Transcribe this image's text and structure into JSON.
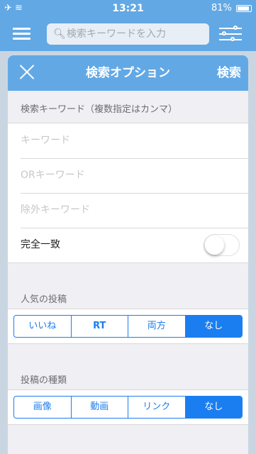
{
  "status_bar": {
    "time": "13:21",
    "battery": "81%"
  },
  "app_bar": {
    "search_placeholder": "検索キーワードを入力"
  },
  "modal": {
    "close_label": "×",
    "title": "検索オプション",
    "search_button": "検索",
    "keyword_section": {
      "label": "検索キーワード（複数指定はカンマ）",
      "keyword_placeholder": "キーワード",
      "or_keyword_placeholder": "ORキーワード",
      "exclude_keyword_placeholder": "除外キーワード",
      "exact_match_label": "完全一致",
      "exact_match_on": false
    },
    "popular_section": {
      "label": "人気の投稿",
      "options": [
        "いいね",
        "RT",
        "両方",
        "なし"
      ],
      "selected": "なし"
    },
    "type_section": {
      "label": "投稿の種類",
      "options": [
        "画像",
        "動画",
        "リンク",
        "なし"
      ],
      "selected": "なし"
    }
  },
  "colors": {
    "header_blue": "#62a8e5",
    "segment_blue": "#1b7ef0"
  }
}
